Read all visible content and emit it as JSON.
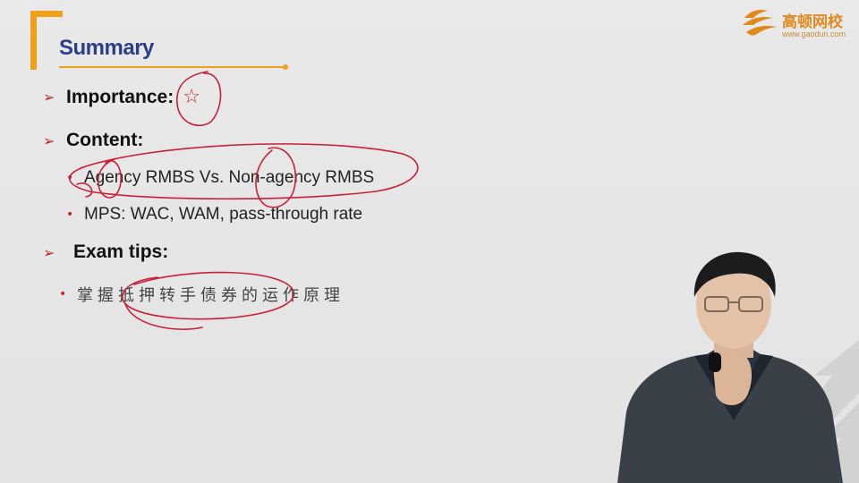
{
  "slide": {
    "title": "Summary",
    "logo": {
      "name_cn": "高顿网校",
      "url": "www.gaodun.com",
      "icon": "gaodun-logo-icon",
      "color": "#e08a1e"
    },
    "sections": [
      {
        "label": "Importance:",
        "rating_icon": "star-outline-icon"
      },
      {
        "label": "Content:",
        "items": [
          "Agency RMBS Vs. Non-agency RMBS",
          "MPS: WAC, WAM, pass-through rate"
        ]
      },
      {
        "label": "Exam tips:",
        "items": [
          "掌握抵押转手债券的运作原理"
        ]
      }
    ],
    "accent_color": "#f0a11a",
    "title_color": "#2c3e88",
    "bullet_color": "#c0282a",
    "annotation_color": "#c8203a"
  }
}
